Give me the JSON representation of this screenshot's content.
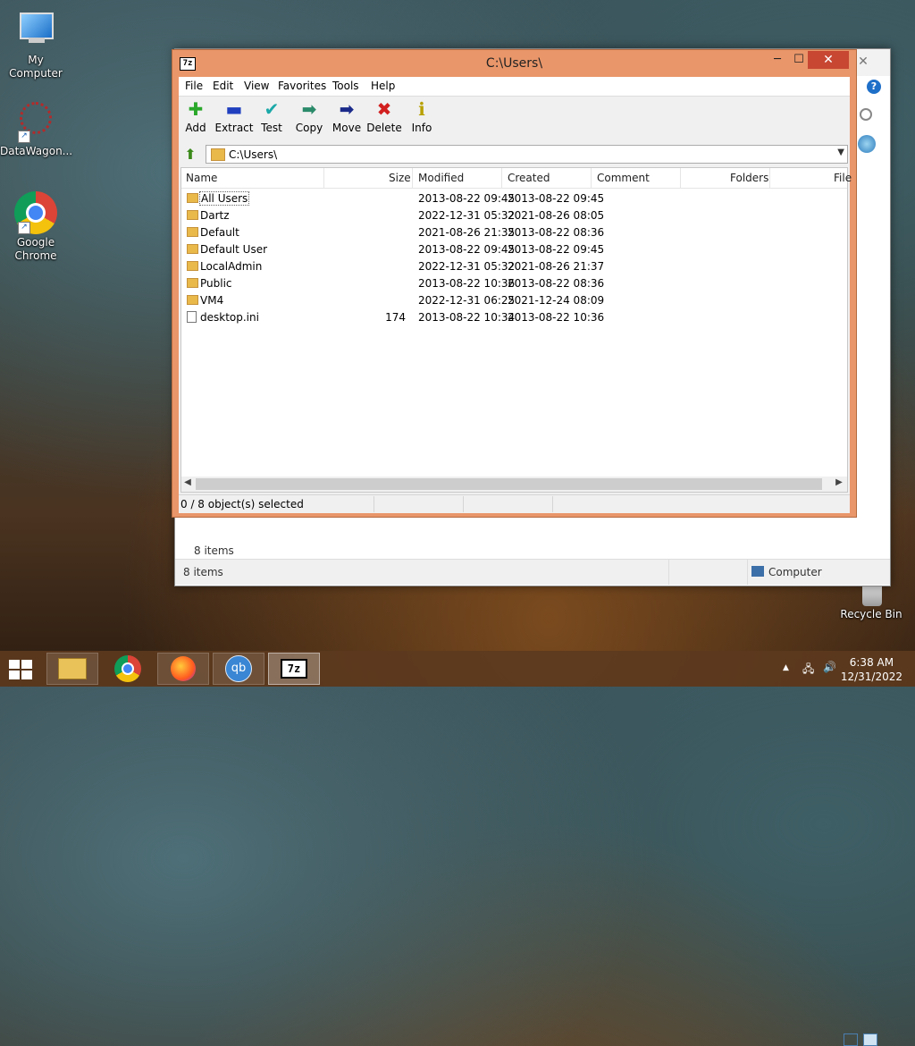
{
  "desktop": {
    "icons": [
      {
        "label": "My Computer"
      },
      {
        "label": "DataWagon..."
      },
      {
        "label": "Google Chrome"
      },
      {
        "label": "Recycle Bin"
      }
    ]
  },
  "back_window": {
    "close_glyph": "✕",
    "help_glyph": "?",
    "status_items_top": "8 items",
    "status_items_bottom": "8 items",
    "status_location": "Computer"
  },
  "window": {
    "title": "C:\\Users\\",
    "app_icon_text": "7z",
    "minimize_glyph": "─",
    "maximize_glyph": "☐",
    "close_glyph": "✕",
    "menu": [
      "File",
      "Edit",
      "View",
      "Favorites",
      "Tools",
      "Help"
    ],
    "toolbar": [
      {
        "label": "Add",
        "icon": "plus-icon",
        "glyph": "✚",
        "color": "#2aa82a"
      },
      {
        "label": "Extract",
        "icon": "minus-icon",
        "glyph": "▬",
        "color": "#1f3fbf"
      },
      {
        "label": "Test",
        "icon": "check-icon",
        "glyph": "✔",
        "color": "#1ba8a8"
      },
      {
        "label": "Copy",
        "icon": "copy-arrow-icon",
        "glyph": "➡",
        "color": "#2a8a6a"
      },
      {
        "label": "Move",
        "icon": "move-arrow-icon",
        "glyph": "➡",
        "color": "#1a2a8a"
      },
      {
        "label": "Delete",
        "icon": "delete-x-icon",
        "glyph": "✖",
        "color": "#d21f1f"
      },
      {
        "label": "Info",
        "icon": "info-icon",
        "glyph": "ℹ",
        "color": "#b8a000"
      }
    ],
    "address": "C:\\Users\\",
    "columns": [
      "Name",
      "Size",
      "Modified",
      "Created",
      "Comment",
      "Folders",
      "File"
    ],
    "rows": [
      {
        "name": "All Users",
        "size": "",
        "modified": "2013-08-22 09:45",
        "created": "2013-08-22 09:45",
        "type": "folder"
      },
      {
        "name": "Dartz",
        "size": "",
        "modified": "2022-12-31 05:32",
        "created": "2021-08-26 08:05",
        "type": "folder"
      },
      {
        "name": "Default",
        "size": "",
        "modified": "2021-08-26 21:35",
        "created": "2013-08-22 08:36",
        "type": "folder"
      },
      {
        "name": "Default User",
        "size": "",
        "modified": "2013-08-22 09:45",
        "created": "2013-08-22 09:45",
        "type": "folder"
      },
      {
        "name": "LocalAdmin",
        "size": "",
        "modified": "2022-12-31 05:32",
        "created": "2021-08-26 21:37",
        "type": "folder"
      },
      {
        "name": "Public",
        "size": "",
        "modified": "2013-08-22 10:36",
        "created": "2013-08-22 08:36",
        "type": "folder"
      },
      {
        "name": "VM4",
        "size": "",
        "modified": "2022-12-31 06:25",
        "created": "2021-12-24 08:09",
        "type": "folder"
      },
      {
        "name": "desktop.ini",
        "size": "174",
        "modified": "2013-08-22 10:34",
        "created": "2013-08-22 10:36",
        "type": "file"
      }
    ],
    "status": "0 / 8 object(s) selected"
  },
  "taskbar": {
    "apps": [
      {
        "name": "file-explorer",
        "glyph": "📁"
      },
      {
        "name": "chrome",
        "glyph": "●"
      },
      {
        "name": "firefox",
        "glyph": "🦊"
      },
      {
        "name": "qbittorrent",
        "glyph": "qb"
      },
      {
        "name": "7zip",
        "glyph": "7z"
      }
    ],
    "tray_up": "▲",
    "tray_network": "🖧",
    "tray_volume": "🔊",
    "time": "6:38 AM",
    "date": "12/31/2022"
  }
}
